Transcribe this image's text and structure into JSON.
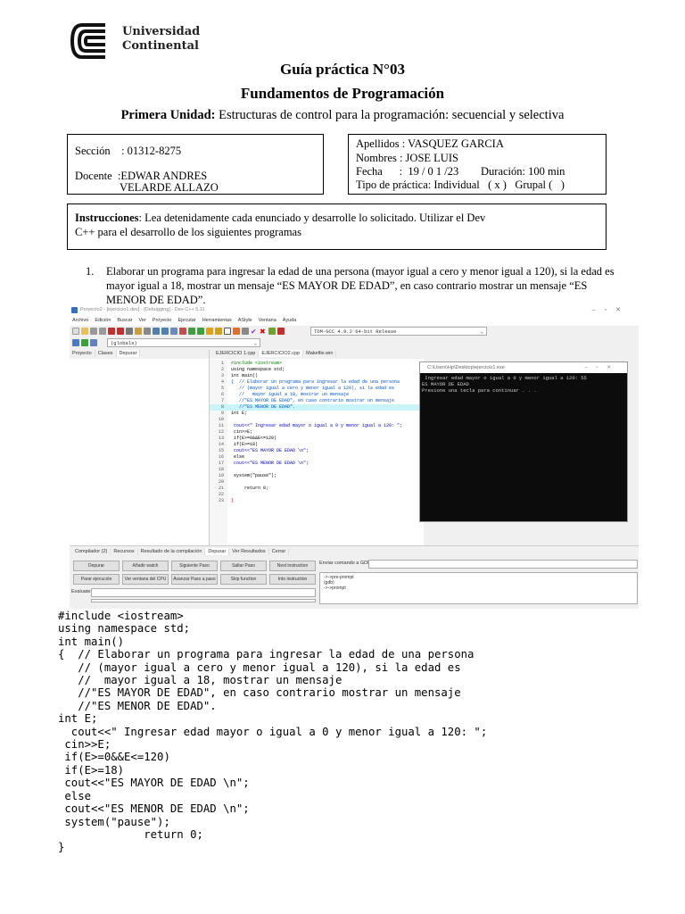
{
  "header": {
    "logo_line1": "Universidad",
    "logo_line2": "Continental",
    "title": "Guía práctica N°03",
    "course": "Fundamentos de Programación",
    "unit_label": "Primera Unidad:",
    "unit_text": " Estructuras de control para la programación: secuencial y selectiva"
  },
  "info_left": {
    "section": "Sección    : 01312-8275",
    "teacher_line1": "Docente  :EDWAR ANDRES",
    "teacher_line2": "VELARDE ALLAZO"
  },
  "info_right": {
    "surname": "Apellidos : VASQUEZ GARCIA",
    "names": "Nombres : JOSE LUIS",
    "date": "Fecha      :  19 / 0 1 /23",
    "duration": "Duración: 100 min",
    "type": "Tipo de práctica: Individual   ( x )   Grupal (   )"
  },
  "instructions": {
    "label": "Instrucciones",
    "text_line1": ": Lea detenidamente cada enunciado y desarrolle lo solicitado. Utilizar el Dev",
    "text_line2": "C++ para el desarrollo de los siguientes programas"
  },
  "exercise": {
    "number": "1.",
    "text": "Elaborar un programa para ingresar la edad de una persona (mayor igual a cero y menor igual a 120), si la edad es mayor igual a 18, mostrar un mensaje “ES MAYOR DE EDAD”, en caso contrario mostrar un mensaje “ES MENOR DE EDAD”."
  },
  "ide": {
    "window_title": "Proyecto2 - [ejercicio1.dev] - [Debugging] - Dev-C++ 5.11",
    "menu": [
      "Archivo",
      "Edición",
      "Buscar",
      "Ver",
      "Proyecto",
      "Ejecutar",
      "Herramientas",
      "AStyle",
      "Ventana",
      "Ayuda"
    ],
    "compiler_select": "TDM-GCC 4.9.2 64-bit Release",
    "scope_select": "(globals)",
    "left_tabs": [
      "Proyecto",
      "Clases",
      "Depurar"
    ],
    "file_tabs": [
      "EJERCICIO 1.cpp",
      "EJERCICIO2.cpp",
      "Makefile.win"
    ],
    "code_lines": [
      {
        "t": "#include <iostream>",
        "c": "#008000"
      },
      {
        "t": "using namespace std;",
        "c": "#000"
      },
      {
        "t": "int main()",
        "c": "#000"
      },
      {
        "t": "{  // Elaborar un programa para ingresar la edad de una persona",
        "c": "#0050c8"
      },
      {
        "t": "   // (mayor igual a cero y menor igual a 120), si la edad es",
        "c": "#0050c8"
      },
      {
        "t": "   //   mayor igual a 18, mostrar un mensaje",
        "c": "#0050c8"
      },
      {
        "t": "   //\"ES MAYOR DE EDAD\", en caso contrario mostrar un mensaje",
        "c": "#0050c8"
      },
      {
        "t": "   //\"ES MENOR DE EDAD\".",
        "c": "#0050c8"
      },
      {
        "t": "int E;",
        "c": "#000"
      },
      {
        "t": "",
        "c": "#000"
      },
      {
        "t": " cout<<\" Ingresar edad mayor o igual a 0 y menor igual a 120: \";",
        "c": "#0000c0"
      },
      {
        "t": " cin>>E;",
        "c": "#000"
      },
      {
        "t": " if(E>=0&&E<=120)",
        "c": "#000"
      },
      {
        "t": " if(E>=18)",
        "c": "#000"
      },
      {
        "t": " cout<<\"ES MAYOR DE EDAD \\n\";",
        "c": "#0000c0"
      },
      {
        "t": " else",
        "c": "#000"
      },
      {
        "t": " cout<<\"ES MENOR DE EDAD \\n\";",
        "c": "#0000c0"
      },
      {
        "t": "",
        "c": "#000"
      },
      {
        "t": " system(\"pause\");",
        "c": "#000"
      },
      {
        "t": "",
        "c": "#000"
      },
      {
        "t": "     return 0;",
        "c": "#000"
      },
      {
        "t": "",
        "c": "#000"
      },
      {
        "t": "}",
        "c": "#e00000"
      }
    ],
    "console_title": "C:\\Users\\Hp\\Desktop\\ejercicio1.exe",
    "console_output": " Ingresar edad mayor o igual a 0 y menor igual a 120: 55\nES MAYOR DE EDAD\nPresione una tecla para continuar . . .",
    "bottom_tabs": [
      "Compilador (2)",
      "Recursos",
      "Resultado de la compilación",
      "Depurar",
      "Ver Resultados",
      "Cerrar"
    ],
    "buttons_row1": [
      "Depurar",
      "Añadir watch",
      "Siguiente Paso",
      "Saltar Paso",
      "Next instruction"
    ],
    "buttons_row2": [
      "Parar ejecución",
      "Ver ventana del CPU",
      "Avanzar Paso a paso",
      "Skip function",
      "Into instruction"
    ],
    "evaluate_label": "Evaluate:",
    "gdb_label": "Enviar comando a GDB:",
    "gdb_output": "->->pre-prompt\n(gdb)\n->->prompt"
  },
  "code_listing": "#include <iostream>\nusing namespace std;\nint main()\n{  // Elaborar un programa para ingresar la edad de una persona\n   // (mayor igual a cero y menor igual a 120), si la edad es\n   //  mayor igual a 18, mostrar un mensaje\n   //\"ES MAYOR DE EDAD\", en caso contrario mostrar un mensaje\n   //\"ES MENOR DE EDAD\".\nint E;\n  cout<<\" Ingresar edad mayor o igual a 0 y menor igual a 120: \";\n cin>>E;\n if(E>=0&&E<=120)\n if(E>=18)\n cout<<\"ES MAYOR DE EDAD \\n\";\n else\n cout<<\"ES MENOR DE EDAD \\n\";\n system(\"pause\");\n             return 0;\n}"
}
